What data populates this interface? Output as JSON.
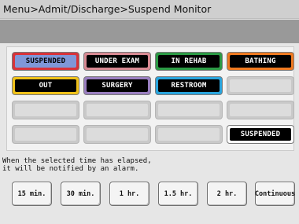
{
  "header": {
    "breadcrumb": "Menu>Admit/Discharge>Suspend Monitor"
  },
  "tiles": [
    {
      "label": "SUSPENDED",
      "border": "#d8333a",
      "fill": "#7f97d8",
      "text": "#000000"
    },
    {
      "label": "UNDER EXAM",
      "border": "#d88a93",
      "fill": "#000000",
      "text": "#ffffff"
    },
    {
      "label": "IN REHAB",
      "border": "#2c9a45",
      "fill": "#000000",
      "text": "#ffffff"
    },
    {
      "label": "BATHING",
      "border": "#ef7a21",
      "fill": "#000000",
      "text": "#ffffff"
    },
    {
      "label": "OUT",
      "border": "#f0c21a",
      "fill": "#000000",
      "text": "#ffffff"
    },
    {
      "label": "SURGERY",
      "border": "#9a7fc0",
      "fill": "#000000",
      "text": "#ffffff"
    },
    {
      "label": "RESTROOM",
      "border": "#2aa5dd",
      "fill": "#000000",
      "text": "#ffffff"
    },
    {
      "label": ""
    },
    {
      "label": ""
    },
    {
      "label": ""
    },
    {
      "label": ""
    },
    {
      "label": ""
    },
    {
      "label": ""
    },
    {
      "label": ""
    },
    {
      "label": ""
    },
    {
      "label": "SUSPENDED",
      "border": "#ffffff",
      "fill": "#000000",
      "text": "#ffffff"
    }
  ],
  "message": "When the selected time has elapsed,\nit will be notified by an alarm.",
  "time_buttons": [
    "15 min.",
    "30 min.",
    "1 hr.",
    "1.5 hr.",
    "2 hr.",
    "Continuous"
  ]
}
